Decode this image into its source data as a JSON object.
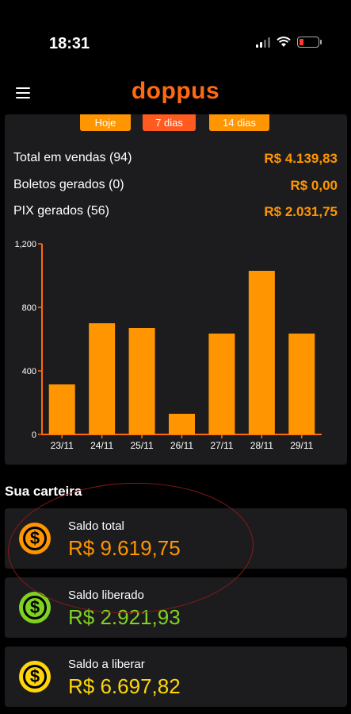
{
  "status_bar": {
    "time": "18:31"
  },
  "header": {
    "logo": "doppus"
  },
  "period_tabs": [
    {
      "label": "Hoje"
    },
    {
      "label": "7 dias"
    },
    {
      "label": "14 dias"
    }
  ],
  "stats": [
    {
      "label": "Total em vendas (94)",
      "value": "R$ 4.139,83"
    },
    {
      "label": "Boletos gerados (0)",
      "value": "R$ 0,00"
    },
    {
      "label": "PIX gerados (56)",
      "value": "R$ 2.031,75"
    }
  ],
  "chart_data": {
    "type": "bar",
    "categories": [
      "23/11",
      "24/11",
      "25/11",
      "26/11",
      "27/11",
      "28/11",
      "29/11"
    ],
    "values": [
      315,
      700,
      670,
      130,
      635,
      1030,
      635
    ],
    "ylim": [
      0,
      1200
    ],
    "yticks": [
      "0",
      "400",
      "800",
      "1,200"
    ],
    "bar_color": "#ff9500",
    "axis_color": "#ff6a10"
  },
  "wallet": {
    "title": "Sua carteira",
    "items": [
      {
        "label": "Saldo total",
        "value": "R$ 9.619,75",
        "color": "#ff9500",
        "icon": "dollar-icon"
      },
      {
        "label": "Saldo liberado",
        "value": "R$ 2.921,93",
        "color": "#7ed321",
        "icon": "dollar-icon"
      },
      {
        "label": "Saldo a liberar",
        "value": "R$ 6.697,82",
        "color": "#ffd60a",
        "icon": "dollar-icon"
      }
    ]
  },
  "colors": {
    "accent": "#ff9500",
    "brand": "#ff6a10",
    "active_tab": "#ff5a1f"
  }
}
